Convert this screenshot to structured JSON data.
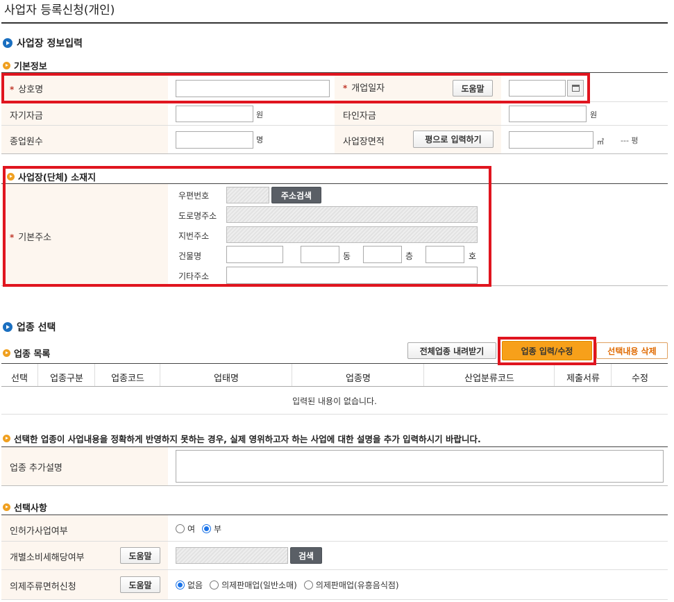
{
  "page": {
    "title": "사업자 등록신청(개인)"
  },
  "section1": {
    "title": "사업장 정보입력",
    "basic_info": "기본정보",
    "trade_name": "상호명",
    "open_date": "개업일자",
    "help": "도움말",
    "own_capital": "자기자금",
    "other_capital": "타인자금",
    "won": "원",
    "employees": "종업원수",
    "person_unit": "명",
    "area": "사업장면적",
    "pyeong_btn": "평으로 입력하기",
    "sqm": "㎡",
    "pyeong_val": "--- 평"
  },
  "location": {
    "title": "사업장(단체) 소재지",
    "basic_address": "기본주소",
    "zip": "우편번호",
    "search_btn": "주소검색",
    "road": "도로명주소",
    "lot": "지번주소",
    "building": "건물명",
    "dong": "동",
    "floor": "층",
    "ho": "호",
    "etc": "기타주소"
  },
  "business": {
    "title": "업종 선택",
    "list_title": "업종 목록",
    "download_btn": "전체업종 내려받기",
    "edit_btn": "업종 입력/수정",
    "delete_btn": "선택내용 삭제",
    "columns": [
      "선택",
      "업종구분",
      "업종코드",
      "업태명",
      "업종명",
      "산업분류코드",
      "제출서류",
      "수정"
    ],
    "empty_msg": "입력된 내용이 없습니다.",
    "notice": "선택한 업종이 사업내용을 정확하게 반영하지 못하는 경우, 실제 영위하고자 하는 사업에 대한 설명을 추가 입력하시기 바랍니다.",
    "extra_desc": "업종 추가설명"
  },
  "options": {
    "title": "선택사항",
    "license": "인허가사업여부",
    "yes": "여",
    "no": "부",
    "excise": "개별소비세해당여부",
    "help": "도움말",
    "search": "검색",
    "liquor": "의제주류면허신청",
    "none": "없음",
    "opt1": "의제판매업(일반소매)",
    "opt2": "의제판매업(유흥음식점)"
  }
}
